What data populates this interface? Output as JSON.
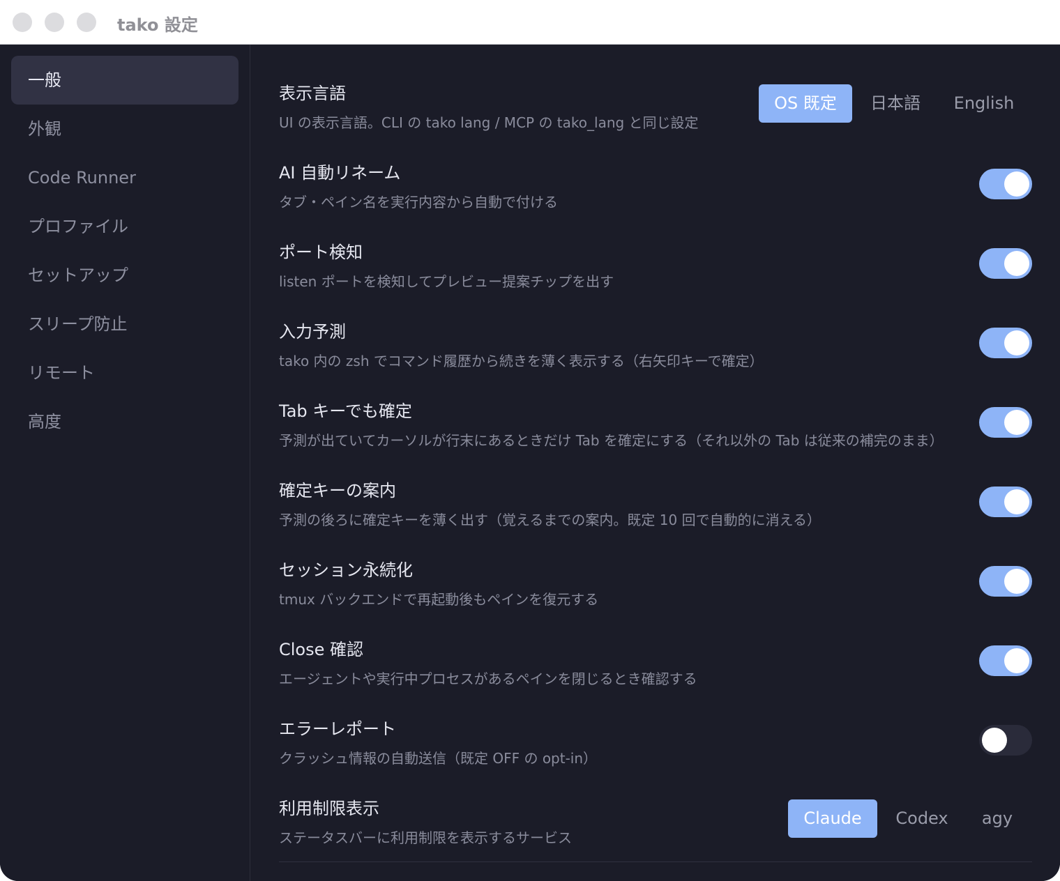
{
  "window": {
    "title": "tako 設定"
  },
  "colors": {
    "accent": "#8eb4f7",
    "background": "#1b1c28",
    "sidebar_active": "#313244"
  },
  "sidebar": {
    "items": [
      {
        "label": "一般",
        "active": true
      },
      {
        "label": "外観"
      },
      {
        "label": "Code Runner"
      },
      {
        "label": "プロファイル"
      },
      {
        "label": "セットアップ"
      },
      {
        "label": "スリープ防止"
      },
      {
        "label": "リモート"
      },
      {
        "label": "高度"
      }
    ]
  },
  "settings": {
    "language": {
      "title": "表示言語",
      "description": "UI の表示言語。CLI の tako lang / MCP の tako_lang と同じ設定",
      "options": [
        "OS 既定",
        "日本語",
        "English"
      ],
      "selected": "OS 既定"
    },
    "toggles": [
      {
        "title": "AI 自動リネーム",
        "description": "タブ・ペイン名を実行内容から自動で付ける",
        "enabled": true
      },
      {
        "title": "ポート検知",
        "description": "listen ポートを検知してプレビュー提案チップを出す",
        "enabled": true
      },
      {
        "title": "入力予測",
        "description": "tako 内の zsh でコマンド履歴から続きを薄く表示する（右矢印キーで確定）",
        "enabled": true
      },
      {
        "title": "Tab キーでも確定",
        "description": "予測が出ていてカーソルが行末にあるときだけ Tab を確定にする（それ以外の Tab は従来の補完のまま）",
        "enabled": true
      },
      {
        "title": "確定キーの案内",
        "description": "予測の後ろに確定キーを薄く出す（覚えるまでの案内。既定 10 回で自動的に消える）",
        "enabled": true
      },
      {
        "title": "セッション永続化",
        "description": "tmux バックエンドで再起動後もペインを復元する",
        "enabled": true
      },
      {
        "title": "Close 確認",
        "description": "エージェントや実行中プロセスがあるペインを閉じるとき確認する",
        "enabled": true
      },
      {
        "title": "エラーレポート",
        "description": "クラッシュ情報の自動送信（既定 OFF の opt-in）",
        "enabled": false
      }
    ],
    "usage": {
      "title": "利用制限表示",
      "description": "ステータスバーに利用制限を表示するサービス",
      "options": [
        "Claude",
        "Codex",
        "agy"
      ],
      "selected": "Claude"
    }
  }
}
